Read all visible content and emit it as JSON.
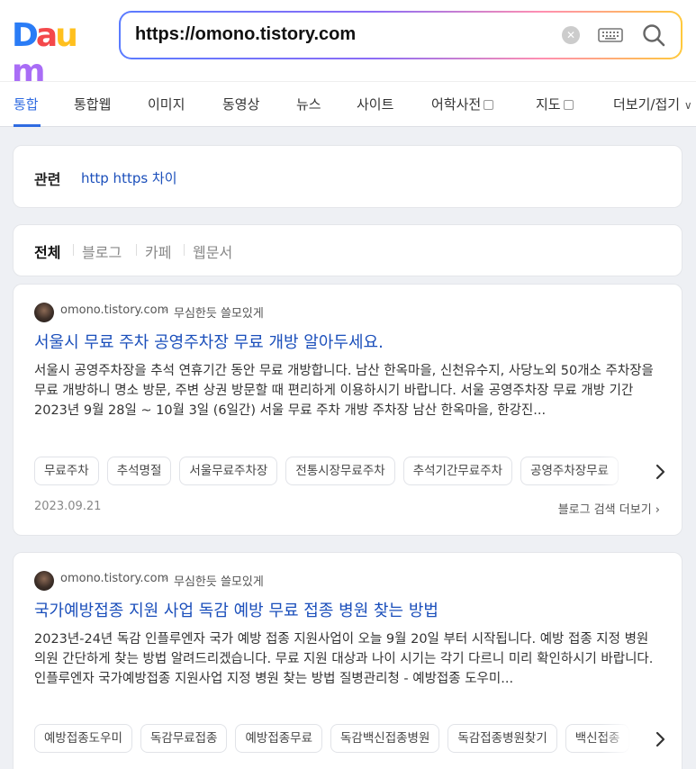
{
  "logo": {
    "text": "Daum",
    "letters": [
      "D",
      "a",
      "u",
      "m"
    ],
    "colors": [
      "#2a7cf6",
      "#f4484b",
      "#ffc01e",
      "#a96df6"
    ]
  },
  "search": {
    "value": "https://omono.tistory.com",
    "clear_icon": "clear-icon",
    "keyboard_icon": "keyboard-icon",
    "search_icon": "search-icon"
  },
  "tabs": [
    {
      "label": "통합",
      "active": true
    },
    {
      "label": "통합웹"
    },
    {
      "label": "이미지"
    },
    {
      "label": "동영상"
    },
    {
      "label": "뉴스"
    },
    {
      "label": "사이트"
    },
    {
      "label": "어학사전",
      "external": true
    },
    {
      "label": "지도",
      "external": true
    },
    {
      "label": "더보기/접기",
      "dropdown": true
    }
  ],
  "related": {
    "label": "관련",
    "link": "http https 차이"
  },
  "filters": [
    "전체",
    "블로그",
    "카페",
    "웹문서"
  ],
  "results": [
    {
      "site": "omono.tistory.com",
      "blog": "무심한듯 쓸모있게",
      "title": "서울시 무료 주차 공영주차장 무료 개방 알아두세요.",
      "desc": "서울시 공영주차장을 추석 연휴기간 동안 무료 개방합니다. 남산 한옥마을, 신천유수지, 사당노외 50개소 주차장을 무료 개방하니 명소 방문, 주변 상권 방문할 때 편리하게 이용하시기 바랍니다. 서울 공영주차장 무료 개방 기간 2023년 9월 28일 ~ 10월 3일 (6일간) 서울 무료 주차 개방 주차장 남산 한옥마을, 한강진...",
      "tags": [
        "무료주차",
        "추석명절",
        "서울무료주차장",
        "전통시장무료주차",
        "추석기간무료주차",
        "공영주차장무료"
      ],
      "date": "2023.09.21",
      "more": "블로그 검색 더보기"
    },
    {
      "site": "omono.tistory.com",
      "blog": "무심한듯 쓸모있게",
      "title": "국가예방접종 지원 사업 독감 예방 무료 접종 병원 찾는 방법",
      "desc": "2023년-24년 독감 인플루엔자 국가 예방 접종 지원사업이 오늘 9월 20일 부터 시작됩니다. 예방 접종 지정 병원 의원 간단하게 찾는 방법 알려드리겠습니다. 무료 지원 대상과 나이 시기는 각기 다르니 미리 확인하시기 바랍니다. 인플루엔자 국가예방접종 지원사업 지정 병원 찾는 방법 질병관리청 - 예방접종 도우미...",
      "tags": [
        "예방접종도우미",
        "독감무료접종",
        "예방접종무료",
        "독감백신접종병원",
        "독감접종병원찾기",
        "백신접종"
      ]
    }
  ]
}
